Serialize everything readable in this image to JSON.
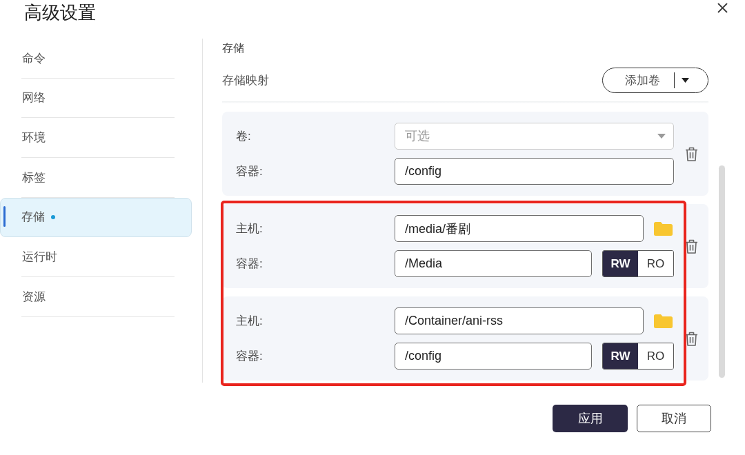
{
  "window": {
    "title": "高级设置"
  },
  "sidebar": {
    "items": [
      {
        "label": "命令",
        "selected": false,
        "modified": false
      },
      {
        "label": "网络",
        "selected": false,
        "modified": false
      },
      {
        "label": "环境",
        "selected": false,
        "modified": false
      },
      {
        "label": "标签",
        "selected": false,
        "modified": false
      },
      {
        "label": "存储",
        "selected": true,
        "modified": true
      },
      {
        "label": "运行时",
        "selected": false,
        "modified": false
      },
      {
        "label": "资源",
        "selected": false,
        "modified": false
      }
    ]
  },
  "section": {
    "title": "存储",
    "mapping_label": "存储映射",
    "add_button": {
      "label": "添加卷"
    }
  },
  "mappings": [
    {
      "kind": "volume",
      "highlighted": false,
      "volume": {
        "label": "卷:",
        "placeholder": "可选"
      },
      "container": {
        "label": "容器:",
        "value": "/config"
      }
    },
    {
      "kind": "bind",
      "highlighted": true,
      "host": {
        "label": "主机:",
        "value": "/media/番剧"
      },
      "container": {
        "label": "容器:",
        "value": "/Media"
      },
      "access": [
        {
          "label": "RW",
          "selected": true
        },
        {
          "label": "RO",
          "selected": false
        }
      ]
    },
    {
      "kind": "bind",
      "highlighted": true,
      "host": {
        "label": "主机:",
        "value": "/Container/ani-rss"
      },
      "container": {
        "label": "容器:",
        "value": "/config"
      },
      "access": [
        {
          "label": "RW",
          "selected": true
        },
        {
          "label": "RO",
          "selected": false
        }
      ]
    }
  ],
  "footer": {
    "buttons": [
      {
        "label": "应用",
        "kind": "primary"
      },
      {
        "label": "取消",
        "kind": "secondary"
      }
    ]
  }
}
